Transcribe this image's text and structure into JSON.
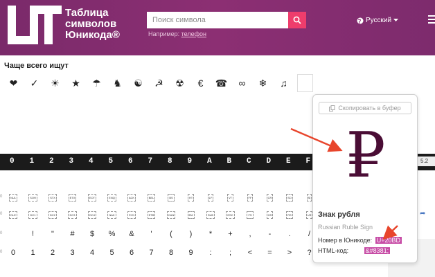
{
  "header": {
    "logo_mark": "UT",
    "logo_line1": "Таблица",
    "logo_line2": "символов",
    "logo_line3": "Юникода®",
    "search_placeholder": "Поиск символа",
    "example_prefix": "Например:",
    "example_link": "телефон",
    "language": "Русский"
  },
  "frequent": {
    "title": "Чаще всего ищут",
    "symbols": [
      "❤",
      "✓",
      "☀",
      "★",
      "☂",
      "♞",
      "☯",
      "☭",
      "☢",
      "€",
      "☎",
      "∞",
      "❄",
      "♫",
      ""
    ]
  },
  "hex_header": [
    "0",
    "1",
    "2",
    "3",
    "4",
    "5",
    "6",
    "7",
    "8",
    "9",
    "A",
    "B",
    "C",
    "D",
    "E",
    "F"
  ],
  "badge_text": "5.2",
  "grid": {
    "row1": [
      "NUL",
      "SOH",
      "STX",
      "ETX",
      "EOT",
      "ENQ",
      "ACK",
      "BEL",
      "BS",
      "HT",
      "LF",
      "VT",
      "FF",
      "CR",
      "SO",
      "SI"
    ],
    "row2": [
      "DLE",
      "DC1",
      "DC2",
      "DC3",
      "DC4",
      "NAK",
      "SYN",
      "ETB",
      "CAN",
      "EM",
      "SUB",
      "ESC",
      "FS",
      "GS",
      "RS",
      "US"
    ],
    "row3": [
      "",
      "!",
      "\"",
      "#",
      "$",
      "%",
      "&",
      "'",
      "(",
      ")",
      "*",
      "+",
      ",",
      "-",
      ".",
      "/"
    ],
    "row4": [
      "0",
      "1",
      "2",
      "3",
      "4",
      "5",
      "6",
      "7",
      "8",
      "9",
      ":",
      ";",
      "<",
      "=",
      ">",
      "?"
    ]
  },
  "popup": {
    "copy_label": "Скопировать в буфер",
    "glyph": "₽",
    "name": "Знак рубля",
    "name_en": "Russian Ruble Sign",
    "unicode_label": "Номер в Юникоде:",
    "unicode_value": "U+20BD",
    "html_label": "HTML-код:",
    "html_value": "&#8381;"
  },
  "colors": {
    "header": "#7a2a6a",
    "accent": "#ee3d6c",
    "code_bg": "#c74da6",
    "arrow": "#e8452c"
  }
}
